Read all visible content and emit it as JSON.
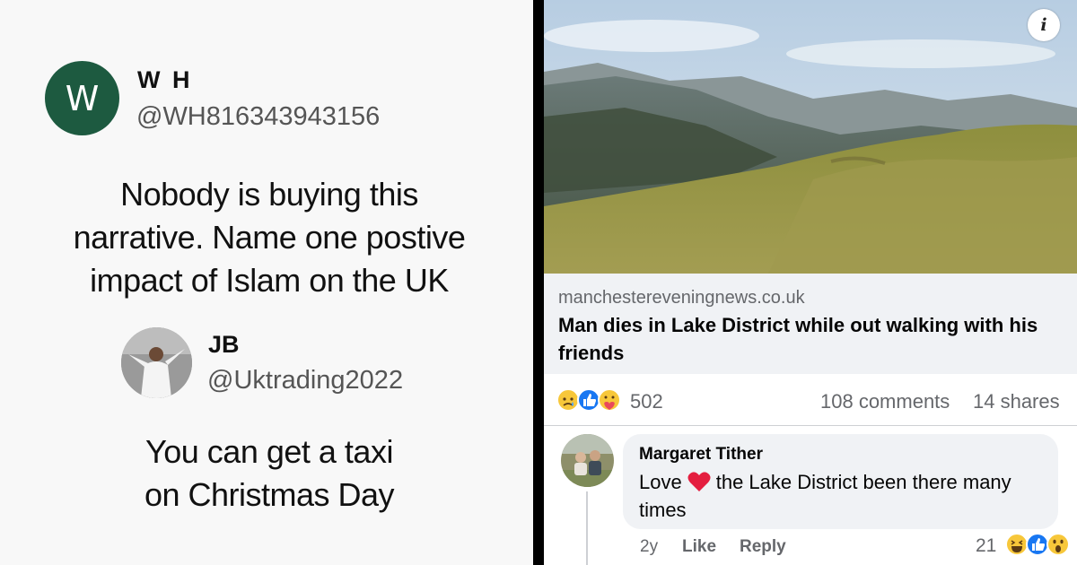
{
  "tweet1": {
    "avatar_letter": "W",
    "name": "W H",
    "handle": "@WH816343943156",
    "text_lines": [
      "Nobody is buying this",
      "narrative. Name one postive",
      "impact of Islam on the UK"
    ]
  },
  "tweet2": {
    "name": "JB",
    "handle": "@Uktrading2022",
    "text_lines": [
      "You can get a taxi",
      "on Christmas Day"
    ]
  },
  "post": {
    "info_icon": "i",
    "domain": "manchestereveningnews.co.uk",
    "headline": "Man dies in Lake District while out walking with his friends",
    "reaction_icons": [
      "sad-reaction-icon",
      "like-reaction-icon",
      "care-reaction-icon"
    ],
    "reaction_count": "502",
    "comments": "108 comments",
    "shares": "14 shares"
  },
  "comment": {
    "author": "Margaret Tither",
    "text_before": "Love",
    "text_after": "the Lake District been there many times",
    "age": "2y",
    "like_label": "Like",
    "reply_label": "Reply",
    "reaction_count": "21",
    "reaction_icons": [
      "haha-reaction-icon",
      "like-reaction-icon",
      "wow-reaction-icon"
    ]
  },
  "colors": {
    "avatar_bg": "#1d5a40",
    "like_blue": "#1877f2",
    "muted": "#65676b",
    "heart": "#e41e3f"
  }
}
